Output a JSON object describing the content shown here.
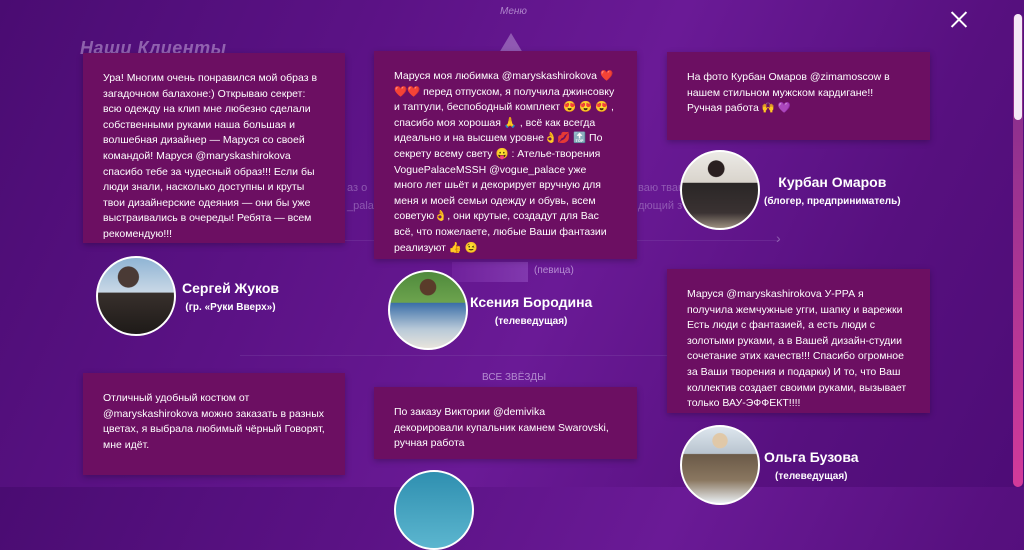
{
  "bg": {
    "menu": "Меню",
    "title": "Наши Клиенты",
    "frag_left": "аз о",
    "frag_left2": "_pala",
    "frag_right": "ваю тваю",
    "frag_right2": "дющий з",
    "caption": "(певица)",
    "all_stars": "ВСЕ ЗВЁЗДЫ"
  },
  "close_label": "×",
  "reviews": [
    {
      "text": "Ура! Многим очень понравился мой образ в загадочном балахоне:) Открываю секрет: всю одежду на клип мне любезно сделали собственными руками наша большая и волшебная дизайнер — Маруся со своей командой! Маруся @maryskashirokova спасибо тебе за чудесный образ!!! Если бы люди знали, насколько доступны и круты твои дизайнерские одеяния — они бы уже выстраивались в очереды! Ребята — всем рекомендую!!!",
      "name": "Сергей Жуков",
      "role": "(гр. «Руки Вверх»)"
    },
    {
      "text": "Маруся моя любимка @maryskashirokova ❤️❤️❤️ перед отпуском, я получила джинсовку и таптули, беспободный комплект 😍 😍 😍 , спасибо моя хорошая 🙏 , всё как всегда идеально и на высшем уровне👌💋 🔝 По секрету всему свету 😛 : Ателье-творения VoguePalaceMSSH @vogue_palace уже много лет шьёт и декорирует вручную для меня и моей семьи одежду и обувь, всем советую👌, они крутые, создадут для Вас всё, что пожелаете, любые Ваши фантазии реализуют 👍 😉",
      "name": "Ксения Бородина",
      "role": "(телеведущая)"
    },
    {
      "text": "На фото Курбан Омаров @zimamoscow в нашем стильном мужском кардигане!! Ручная работа 🙌 💜",
      "name": "Курбан Омаров",
      "role": "(блогер, предприниматель)"
    },
    {
      "text": "Маруся @maryskashirokova У-РРА я получила жемчужные угги, шапку и варежки Есть люди с фантазией, а есть люди с золотыми руками, а в Вашей дизайн-студии сочетание этих качеств!!! Спасибо огромное за Ваши творения и подарки) И то, что Ваш коллектив создает своими руками, вызывает только ВАУ-ЭФФЕКТ!!!!",
      "name": "Ольга Бузова",
      "role": "(телеведущая)"
    },
    {
      "text": "Отличный удобный костюм от @maryskashirokova можно заказать в разных цветах, я выбрала любимый чёрный Говорят, мне идёт."
    },
    {
      "text": "По заказу Виктории @demivika декорировали купальник камнем Swarovski, ручная работа"
    }
  ]
}
